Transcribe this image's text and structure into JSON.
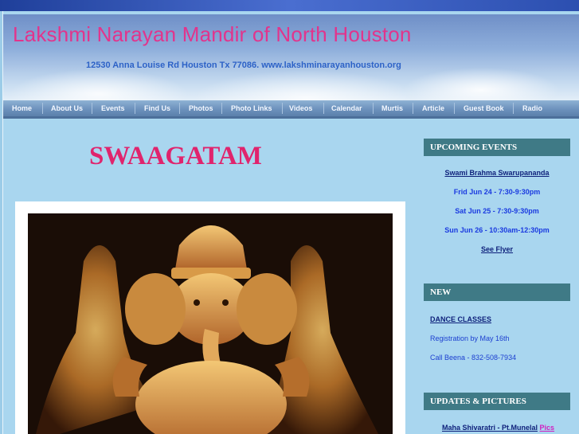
{
  "header": {
    "title": "Lakshmi Narayan Mandir of North Houston",
    "address": "12530 Anna Louise Rd Houston Tx 77086. www.lakshminarayanhouston.org"
  },
  "nav": {
    "items": [
      "Home",
      "About Us",
      "Events",
      "Find Us",
      "Photos",
      "Photo Links",
      "Videos",
      "Calendar",
      "Murtis",
      "Article",
      "Guest Book",
      "Radio"
    ]
  },
  "main": {
    "welcome": "SWAAGATAM"
  },
  "sidebar": {
    "upcoming": {
      "heading": "UPCOMING EVENTS",
      "event_name": "Swami Brahma Swarupananda",
      "dates": [
        "Frid Jun 24 - 7:30-9:30pm",
        "Sat Jun 25 - 7:30-9:30pm",
        "Sun Jun 26 - 10:30am-12:30pm"
      ],
      "flyer_link": "See Flyer"
    },
    "new": {
      "heading": "NEW",
      "link": "DANCE CLASSES",
      "registration": "Registration by May 16th",
      "contact": "Call Beena - 832-508-7934"
    },
    "updates": {
      "heading": "UPDATES & PICTURES",
      "link": "Maha Shivaratri - Pt.Munelal",
      "pics": "Pics"
    }
  },
  "colors": {
    "title": "#e2348c",
    "welcome": "#e0246d",
    "sidebar_heading": "#3f7a86",
    "page_background": "#a9d6ef"
  }
}
